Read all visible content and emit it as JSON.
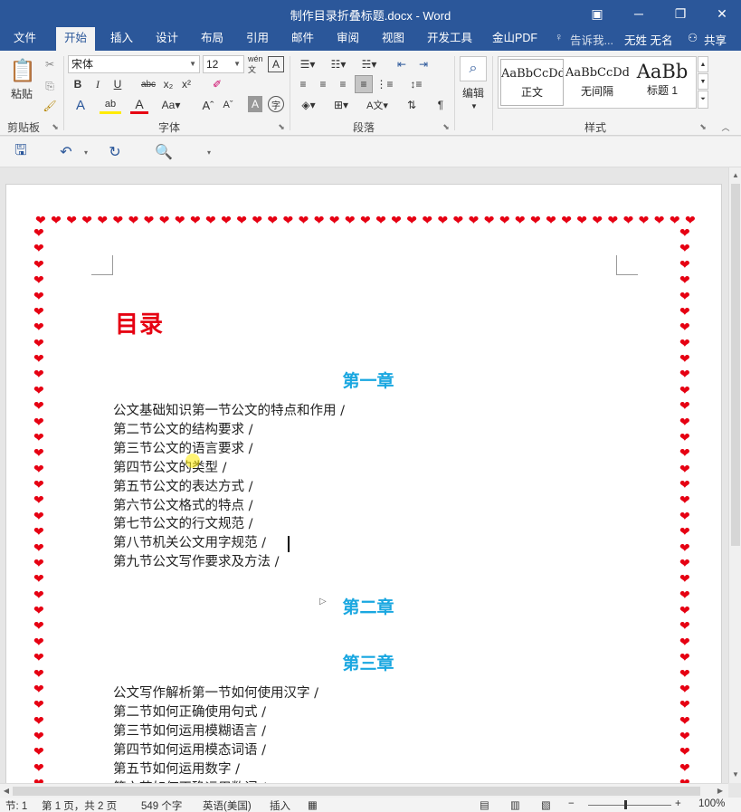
{
  "window": {
    "title": "制作目录折叠标题.docx - Word"
  },
  "tabs": [
    "文件",
    "开始",
    "插入",
    "设计",
    "布局",
    "引用",
    "邮件",
    "审阅",
    "视图",
    "开发工具",
    "金山PDF"
  ],
  "active_tab": "开始",
  "tell_me": "告诉我...",
  "user": "无姓 无名",
  "share": "共享",
  "ribbon": {
    "clipboard": {
      "paste": "粘贴",
      "label": "剪贴板"
    },
    "font": {
      "name": "宋体",
      "size": "12",
      "label": "字体"
    },
    "paragraph": {
      "label": "段落"
    },
    "editing": {
      "label": "编辑"
    },
    "styles": {
      "label": "样式",
      "items": [
        {
          "sample": "AaBbCcDd",
          "name": "正文"
        },
        {
          "sample": "AaBbCcDd",
          "name": "无间隔"
        },
        {
          "sample": "AaBb",
          "name": "标题 1"
        }
      ]
    }
  },
  "document": {
    "toc_title": "目录",
    "chapter1": {
      "title": "第一章",
      "lines": [
        "公文基础知识第一节公文的特点和作用 /",
        "第二节公文的结构要求 /",
        "第三节公文的语言要求 /",
        "第四节公文的类型 /",
        "第五节公文的表达方式 /",
        "第六节公文格式的特点 /",
        "第七节公文的行文规范 /",
        "第八节机关公文用字规范 /",
        "第九节公文写作要求及方法 /"
      ]
    },
    "chapter2": {
      "title": "第二章"
    },
    "chapter3": {
      "title": "第三章",
      "lines": [
        "公文写作解析第一节如何使用汉字 /",
        "第二节如何正确使用句式 /",
        "第三节如何运用模糊语言 /",
        "第四节如何运用模态词语 /",
        "第五节如何运用数字 /",
        "第六节如何正确运用数词 /"
      ]
    },
    "border_color": "#e60012",
    "chapter_color": "#1aa7e0"
  },
  "status": {
    "section": "节: 1",
    "page": "第 1 页，共 2 页",
    "words": "549 个字",
    "language": "英语(美国)",
    "mode": "插入",
    "zoom": "100%"
  },
  "colors": {
    "accent": "#2b579a",
    "toc_title": "#e60012"
  }
}
